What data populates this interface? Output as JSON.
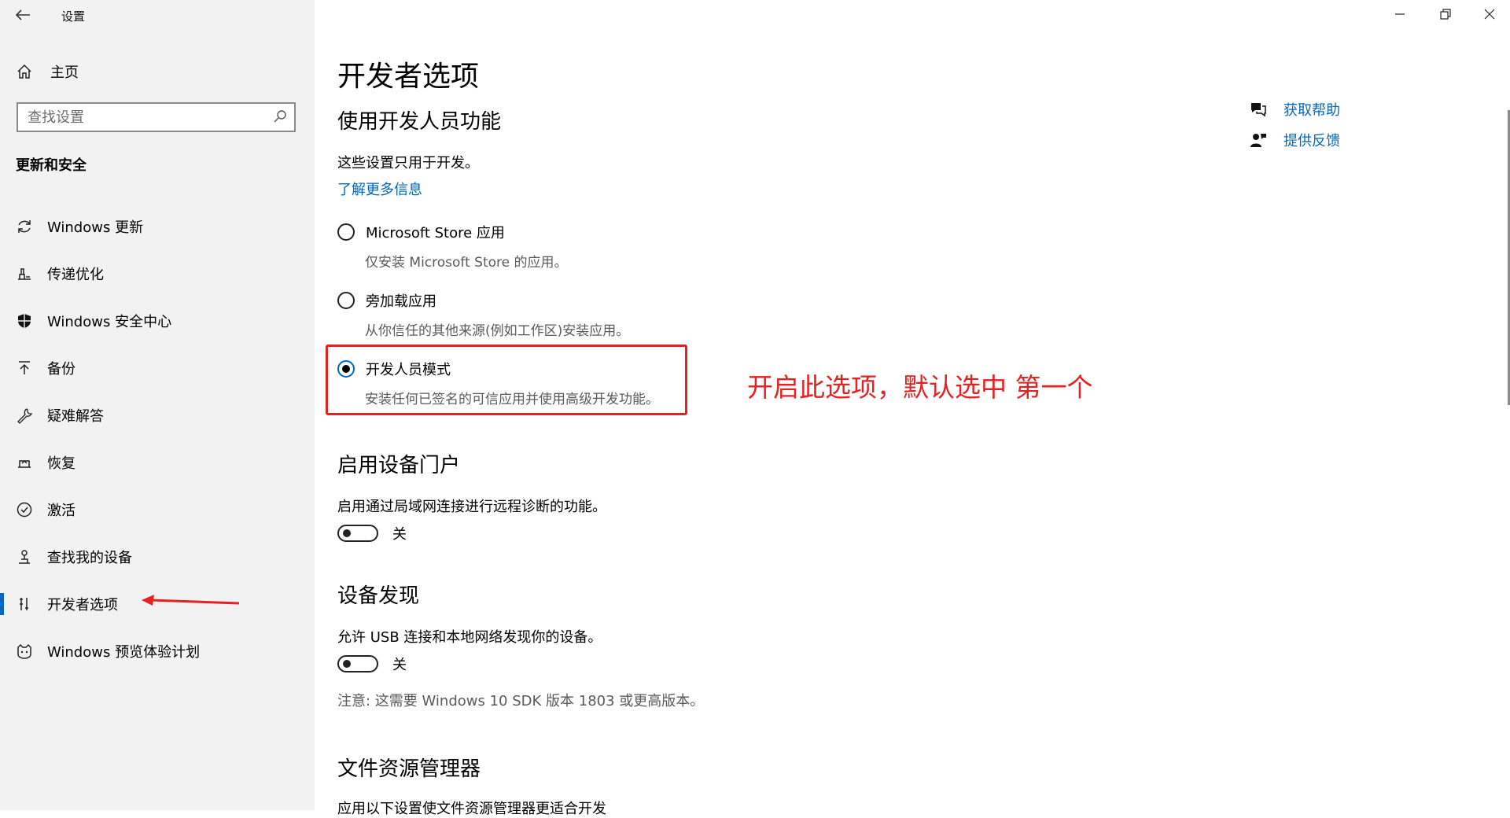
{
  "window": {
    "title": "设置"
  },
  "sidebar": {
    "home_label": "主页",
    "search_placeholder": "查找设置",
    "section_title": "更新和安全",
    "items": [
      {
        "label": "Windows 更新",
        "icon": "sync-icon"
      },
      {
        "label": "传递优化",
        "icon": "delivery-icon"
      },
      {
        "label": "Windows 安全中心",
        "icon": "shield-icon"
      },
      {
        "label": "备份",
        "icon": "backup-arrow-icon"
      },
      {
        "label": "疑难解答",
        "icon": "wrench-icon"
      },
      {
        "label": "恢复",
        "icon": "recovery-icon"
      },
      {
        "label": "激活",
        "icon": "check-circle-icon"
      },
      {
        "label": "查找我的设备",
        "icon": "find-device-icon"
      },
      {
        "label": "开发者选项",
        "icon": "developer-icon",
        "active": true
      },
      {
        "label": "Windows 预览体验计划",
        "icon": "insider-cat-icon"
      }
    ]
  },
  "main": {
    "title": "开发者选项",
    "dev_section": {
      "heading": "使用开发人员功能",
      "desc": "这些设置只用于开发。",
      "link": "了解更多信息",
      "options": [
        {
          "label": "Microsoft Store 应用",
          "desc": "仅安装 Microsoft Store 的应用。",
          "selected": false
        },
        {
          "label": "旁加载应用",
          "desc": "从你信任的其他来源(例如工作区)安装应用。",
          "selected": false
        },
        {
          "label": "开发人员模式",
          "desc": "安装任何已签名的可信应用并使用高级开发功能。",
          "selected": true
        }
      ]
    },
    "portal": {
      "heading": "启用设备门户",
      "desc": "启用通过局域网连接进行远程诊断的功能。",
      "toggle_label": "关"
    },
    "discovery": {
      "heading": "设备发现",
      "desc": "允许 USB 连接和本地网络发现你的设备。",
      "toggle_label": "关",
      "note": "注意: 这需要 Windows 10 SDK 版本 1803 或更高版本。"
    },
    "explorer": {
      "heading": "文件资源管理器",
      "desc": "应用以下设置使文件资源管理器更适合开发"
    },
    "help": {
      "get_help": "获取帮助",
      "feedback": "提供反馈"
    }
  },
  "annotation": {
    "text": "开启此选项，默认选中 第一个",
    "color": "#e52222"
  },
  "colors": {
    "accent": "#0067c0",
    "sidebar_bg": "#f2f2f2"
  }
}
